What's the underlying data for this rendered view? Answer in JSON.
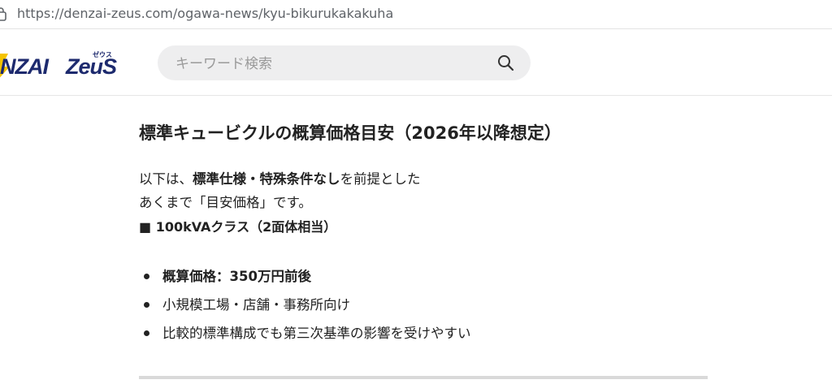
{
  "browser": {
    "url": "https://denzai-zeus.com/ogawa-news/kyu-bikurukakakuha"
  },
  "header": {
    "logo_text_left": "NZAI",
    "logo_text_right": "ZeuS",
    "logo_kana": "ゼウス",
    "search": {
      "placeholder": "キーワード検索",
      "value": ""
    }
  },
  "article": {
    "title": "標準キュービクルの概算価格目安（2026年以降想定）",
    "intro": {
      "line1_pre": "以下は、",
      "line1_bold": "標準仕様・特殊条件なし",
      "line1_post": "を前提とした",
      "line2": "あくまで「目安価格」です。"
    },
    "subheading": "■ 100kVAクラス（2面体相当）",
    "bullets": [
      "概算価格：350万円前後",
      "小規模工場・店舗・事務所向け",
      "比較的標準構成でも第三次基準の影響を受けやすい"
    ]
  },
  "colors": {
    "logo_navy": "#1d2a6e",
    "logo_yellow": "#f5c400",
    "search_bg": "#eeeeef",
    "divider": "#d9d9d9"
  }
}
